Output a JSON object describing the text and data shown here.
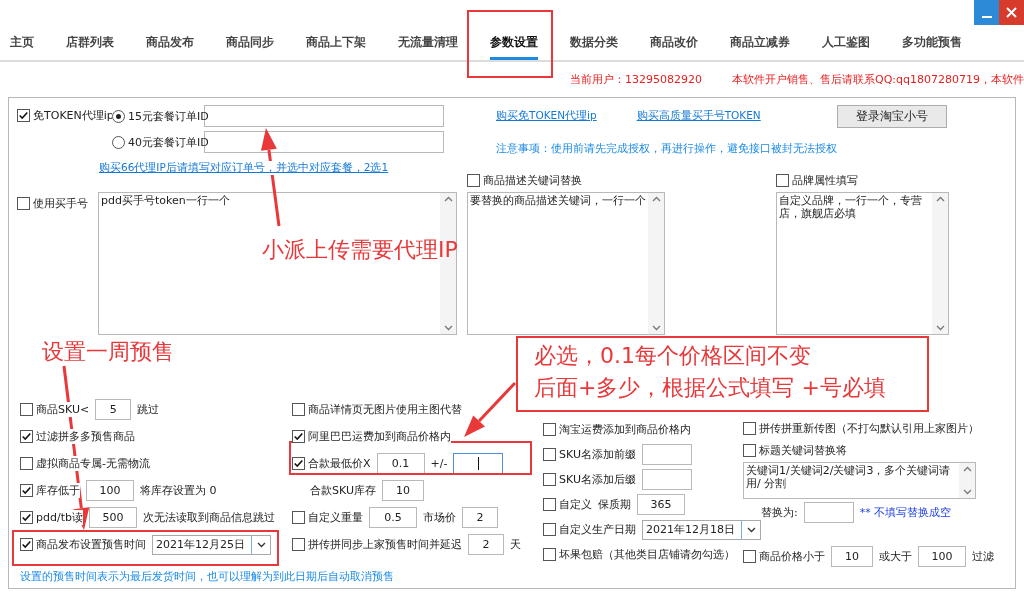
{
  "tabs": [
    {
      "label": "主页",
      "selected": false
    },
    {
      "label": "店群列表",
      "selected": false
    },
    {
      "label": "商品发布",
      "selected": false
    },
    {
      "label": "商品同步",
      "selected": false
    },
    {
      "label": "商品上下架",
      "selected": false
    },
    {
      "label": "无流量清理",
      "selected": false
    },
    {
      "label": "参数设置",
      "selected": true
    },
    {
      "label": "数据分类",
      "selected": false
    },
    {
      "label": "商品改价",
      "selected": false
    },
    {
      "label": "商品立减券",
      "selected": false
    },
    {
      "label": "人工鉴图",
      "selected": false
    },
    {
      "label": "多功能预售",
      "selected": false
    }
  ],
  "info": {
    "user": "当前用户：13295082920",
    "notice": "本软件开户销售、售后请联系QQ:qq1807280719，本软件"
  },
  "proxy": {
    "checkbox": {
      "label": "免TOKEN代理ip",
      "checked": true
    },
    "options": [
      {
        "label": "15元套餐订单ID",
        "selected": true
      },
      {
        "label": "40元套餐订单ID",
        "selected": false
      }
    ],
    "buy_link": "购买66代理IP后请填写对应订单号，并选中对应套餐，2选1"
  },
  "links": [
    "购买免TOKEN代理ip",
    "购买高质量买手号TOKEN"
  ],
  "login_button": "登录淘宝小号",
  "notice": "注意事项：使用前请先完成授权，再进行操作，避免接口被封无法授权",
  "text_panels": [
    {
      "checkbox": {
        "label": "使用买手号",
        "checked": false
      },
      "value": "pdd买手号token一行一个"
    },
    {
      "checkbox": {
        "label": "商品描述关键词替换",
        "checked": false
      },
      "value": "要替换的商品描述关键词，一行一个"
    },
    {
      "checkbox": {
        "label": "品牌属性填写",
        "checked": false
      },
      "value": "自定义品牌，一行一个，专营店，旗舰店必填"
    }
  ],
  "columns": [
    {
      "rows": [
        {
          "parts": [
            {
              "kind": "check",
              "label": "商品SKU<",
              "checked": false
            },
            {
              "kind": "input",
              "value": "5"
            },
            {
              "kind": "text",
              "text": "跳过"
            }
          ]
        },
        {
          "parts": [
            {
              "kind": "check",
              "label": "过滤拼多多预售商品",
              "checked": true
            }
          ]
        },
        {
          "parts": [
            {
              "kind": "check",
              "label": "虚拟商品专属-无需物流",
              "checked": false
            }
          ]
        },
        {
          "parts": [
            {
              "kind": "check",
              "label": "库存低于",
              "checked": true
            },
            {
              "kind": "input",
              "value": "100"
            },
            {
              "kind": "text",
              "text": "将库存设置为 0"
            }
          ]
        },
        {
          "parts": [
            {
              "kind": "check",
              "label": "pdd/tb读",
              "checked": true
            },
            {
              "kind": "input",
              "value": "500"
            },
            {
              "kind": "text",
              "text": "次无法读取到商品信息跳过"
            }
          ]
        },
        {
          "parts": [
            {
              "kind": "check",
              "label": "商品发布设置预售时间",
              "checked": true
            },
            {
              "kind": "date",
              "value": "2021年12月25日"
            }
          ]
        }
      ]
    },
    {
      "rows": [
        {
          "parts": [
            {
              "kind": "check",
              "label": "商品详情页无图片使用主图代替",
              "checked": false
            }
          ]
        },
        {
          "parts": [
            {
              "kind": "check",
              "label": "阿里巴巴运费加到商品价格内",
              "checked": true
            }
          ]
        },
        {
          "parts": [
            {
              "kind": "check",
              "label": "合款最低价X",
              "checked": true
            },
            {
              "kind": "input",
              "value": "0.1"
            },
            {
              "kind": "text",
              "text": "+/-"
            },
            {
              "kind": "input",
              "focused": true
            }
          ]
        },
        {
          "parts": [
            {
              "kind": "text",
              "text": "合款SKU库存"
            },
            {
              "kind": "input",
              "value": "10"
            }
          ]
        },
        {
          "parts": [
            {
              "kind": "check",
              "label": "自定义重量",
              "checked": false
            },
            {
              "kind": "input",
              "value": "0.5"
            },
            {
              "kind": "text",
              "text": "市场价"
            },
            {
              "kind": "input",
              "value": "2"
            }
          ]
        },
        {
          "parts": [
            {
              "kind": "check",
              "label": "拼传拼同步上家预售时间并延迟",
              "checked": false
            },
            {
              "kind": "input",
              "value": "2"
            },
            {
              "kind": "text",
              "text": "天"
            }
          ]
        }
      ]
    },
    {
      "rows": [
        {
          "parts": [
            {
              "kind": "check",
              "label": "淘宝运费添加到商品价格内",
              "checked": false
            }
          ]
        },
        {
          "parts": [
            {
              "kind": "check",
              "label": "SKU名添加前缀",
              "checked": false
            },
            {
              "kind": "input"
            }
          ]
        },
        {
          "parts": [
            {
              "kind": "check",
              "label": "SKU名添加后缀",
              "checked": false
            },
            {
              "kind": "input"
            }
          ]
        },
        {
          "parts": [
            {
              "kind": "check",
              "label": "自定义",
              "checked": false
            },
            {
              "kind": "text",
              "text": "保质期"
            },
            {
              "kind": "input",
              "value": "365"
            }
          ]
        },
        {
          "parts": [
            {
              "kind": "check",
              "label": "自定义生产日期",
              "checked": false
            },
            {
              "kind": "date",
              "value": "2021年12月18日"
            }
          ]
        },
        {
          "parts": [
            {
              "kind": "check",
              "label": "坏果包赔（其他类目店铺请勿勾选）",
              "checked": false
            }
          ]
        }
      ]
    },
    {
      "rows": [
        {
          "parts": [
            {
              "kind": "check",
              "label": "拼传拼重新传图（不打勾默认引用上家图片）",
              "checked": false
            }
          ]
        },
        {
          "parts": [
            {
              "kind": "check",
              "label": "标题关键词替换将",
              "checked": false
            }
          ]
        },
        {
          "parts": [
            {
              "kind": "textarea",
              "value": "关键词1/关键词2/关键词3，多个关键词请用/ 分割"
            }
          ]
        },
        {
          "parts": [
            {
              "kind": "text",
              "text": "替换为:"
            },
            {
              "kind": "input"
            },
            {
              "kind": "hint",
              "text": "** 不填写替换成空"
            }
          ]
        },
        {
          "parts": [
            {
              "kind": "check",
              "label": "商品价格小于",
              "checked": false
            },
            {
              "kind": "input",
              "value": "10"
            },
            {
              "kind": "text",
              "text": "或大于"
            },
            {
              "kind": "input",
              "value": "100"
            },
            {
              "kind": "text",
              "text": "过滤"
            }
          ]
        }
      ]
    }
  ],
  "footer_note": "设置的预售时间表示为最后发货时间，也可以理解为到此日期后自动取消预售",
  "annotations": {
    "proxy_label": "小派上传需要代理IP",
    "presale_label": "设置一周预售",
    "callout": [
      "必选，0.1每个价格区间不变",
      "后面+多少，根据公式填写 +号必填"
    ]
  }
}
